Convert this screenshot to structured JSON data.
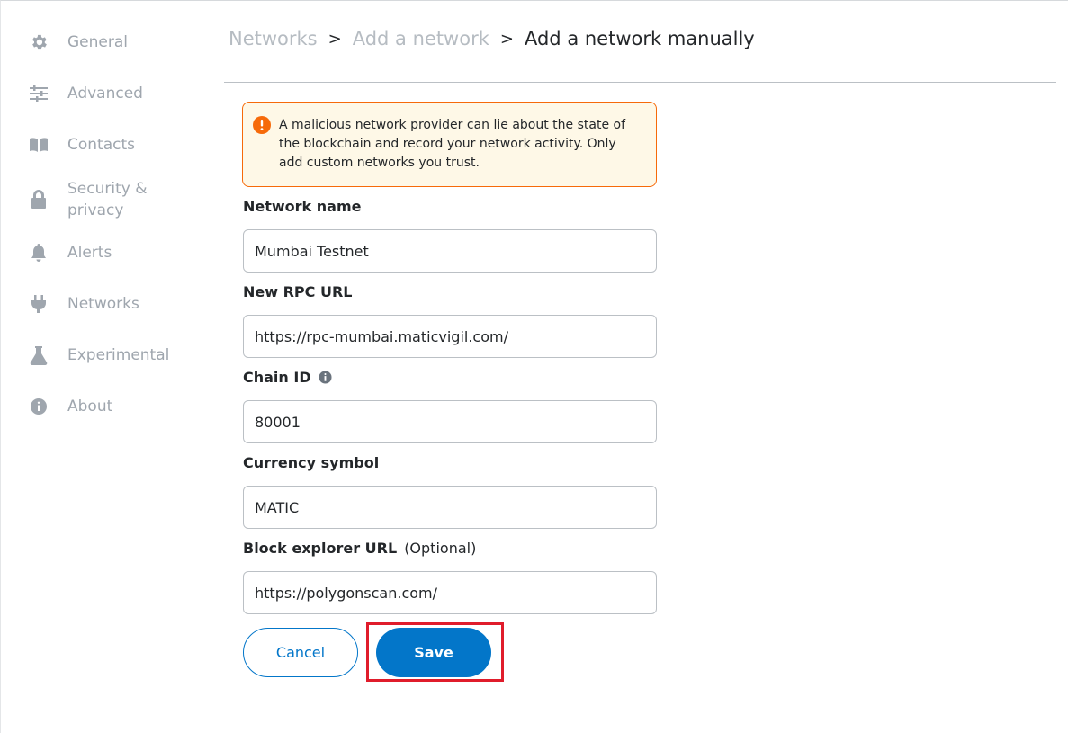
{
  "sidebar": {
    "items": [
      {
        "label": "General",
        "icon": "gear-icon"
      },
      {
        "label": "Advanced",
        "icon": "sliders-icon"
      },
      {
        "label": "Contacts",
        "icon": "book-icon"
      },
      {
        "label": "Security & privacy",
        "icon": "lock-icon"
      },
      {
        "label": "Alerts",
        "icon": "bell-icon"
      },
      {
        "label": "Networks",
        "icon": "plug-icon"
      },
      {
        "label": "Experimental",
        "icon": "flask-icon"
      },
      {
        "label": "About",
        "icon": "info-icon"
      }
    ]
  },
  "breadcrumb": {
    "networks": "Networks",
    "add_network": "Add a network",
    "separator": ">",
    "current": "Add a network manually"
  },
  "warning": {
    "text": "A malicious network provider can lie about the state of the blockchain and record your network activity. Only add custom networks you trust.",
    "border_color": "#f66a0a",
    "background": "#fef8e7"
  },
  "form": {
    "network_name": {
      "label": "Network name",
      "value": "Mumbai Testnet"
    },
    "rpc_url": {
      "label": "New RPC URL",
      "value": "https://rpc-mumbai.maticvigil.com/"
    },
    "chain_id": {
      "label": "Chain ID",
      "value": "80001"
    },
    "currency_symbol": {
      "label": "Currency symbol",
      "value": "MATIC"
    },
    "block_explorer": {
      "label": "Block explorer URL",
      "optional": "(Optional)",
      "value": "https://polygonscan.com/"
    }
  },
  "buttons": {
    "cancel": "Cancel",
    "save": "Save"
  },
  "colors": {
    "accent": "#0376c9",
    "highlight": "#e01c2b"
  }
}
